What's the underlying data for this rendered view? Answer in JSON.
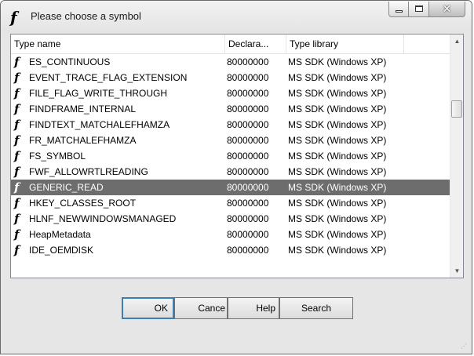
{
  "window": {
    "title": "Please choose a symbol",
    "title_icon": "function-symbol-icon",
    "caption_buttons": [
      "minimize",
      "maximize",
      "close"
    ]
  },
  "list": {
    "columns": [
      "Type name",
      "Declara...",
      "Type library"
    ],
    "rows": [
      {
        "name": "ES_CONTINUOUS",
        "declaration": "80000000",
        "library": "MS SDK (Windows XP)"
      },
      {
        "name": "EVENT_TRACE_FLAG_EXTENSION",
        "declaration": "80000000",
        "library": "MS SDK (Windows XP)"
      },
      {
        "name": "FILE_FLAG_WRITE_THROUGH",
        "declaration": "80000000",
        "library": "MS SDK (Windows XP)"
      },
      {
        "name": "FINDFRAME_INTERNAL",
        "declaration": "80000000",
        "library": "MS SDK (Windows XP)"
      },
      {
        "name": "FINDTEXT_MATCHALEFHAMZA",
        "declaration": "80000000",
        "library": "MS SDK (Windows XP)"
      },
      {
        "name": "FR_MATCHALEFHAMZA",
        "declaration": "80000000",
        "library": "MS SDK (Windows XP)"
      },
      {
        "name": "FS_SYMBOL",
        "declaration": "80000000",
        "library": "MS SDK (Windows XP)"
      },
      {
        "name": "FWF_ALLOWRTLREADING",
        "declaration": "80000000",
        "library": "MS SDK (Windows XP)"
      },
      {
        "name": "GENERIC_READ",
        "declaration": "80000000",
        "library": "MS SDK (Windows XP)",
        "selected": true
      },
      {
        "name": "HKEY_CLASSES_ROOT",
        "declaration": "80000000",
        "library": "MS SDK (Windows XP)"
      },
      {
        "name": "HLNF_NEWWINDOWSMANAGED",
        "declaration": "80000000",
        "library": "MS SDK (Windows XP)"
      },
      {
        "name": "HeapMetadata",
        "declaration": "80000000",
        "library": "MS SDK (Windows XP)"
      },
      {
        "name": "IDE_OEMDISK",
        "declaration": "80000000",
        "library": "MS SDK (Windows XP)"
      }
    ],
    "row_icon": "function-symbol-icon"
  },
  "buttons": {
    "ok": "OK",
    "cancel": "Cance",
    "help": "Help",
    "search": "Search"
  }
}
